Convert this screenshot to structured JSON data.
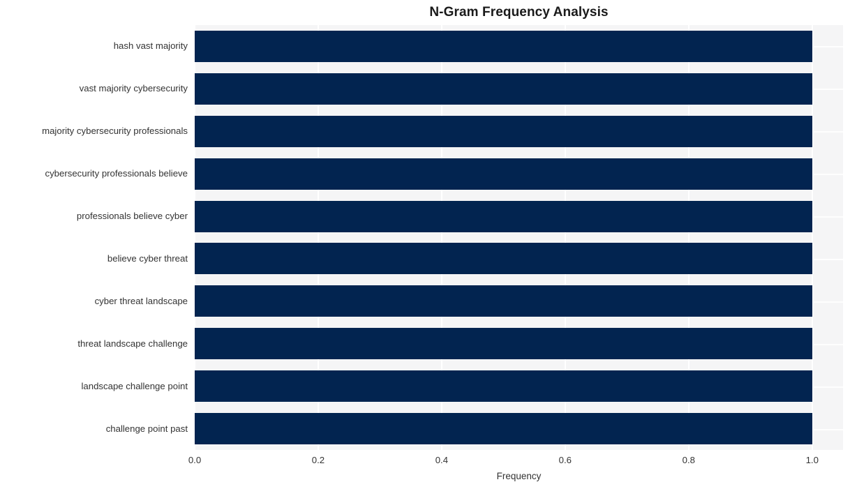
{
  "chart_data": {
    "type": "bar",
    "orientation": "horizontal",
    "title": "N-Gram Frequency Analysis",
    "xlabel": "Frequency",
    "ylabel": "",
    "categories": [
      "hash vast majority",
      "vast majority cybersecurity",
      "majority cybersecurity professionals",
      "cybersecurity professionals believe",
      "professionals believe cyber",
      "believe cyber threat",
      "cyber threat landscape",
      "threat landscape challenge",
      "landscape challenge point",
      "challenge point past"
    ],
    "values": [
      1.0,
      1.0,
      1.0,
      1.0,
      1.0,
      1.0,
      1.0,
      1.0,
      1.0,
      1.0
    ],
    "xlim": [
      0.0,
      1.05
    ],
    "xticks": [
      "0.0",
      "0.2",
      "0.4",
      "0.6",
      "0.8",
      "1.0"
    ],
    "xtick_values": [
      0.0,
      0.2,
      0.4,
      0.6,
      0.8,
      1.0
    ],
    "grid": true,
    "legend": false,
    "bar_color": "#022450",
    "plot_background": "#f5f5f6",
    "grid_color": "#ffffff",
    "text_color": "#333333",
    "title_color": "#1a1a1a"
  }
}
